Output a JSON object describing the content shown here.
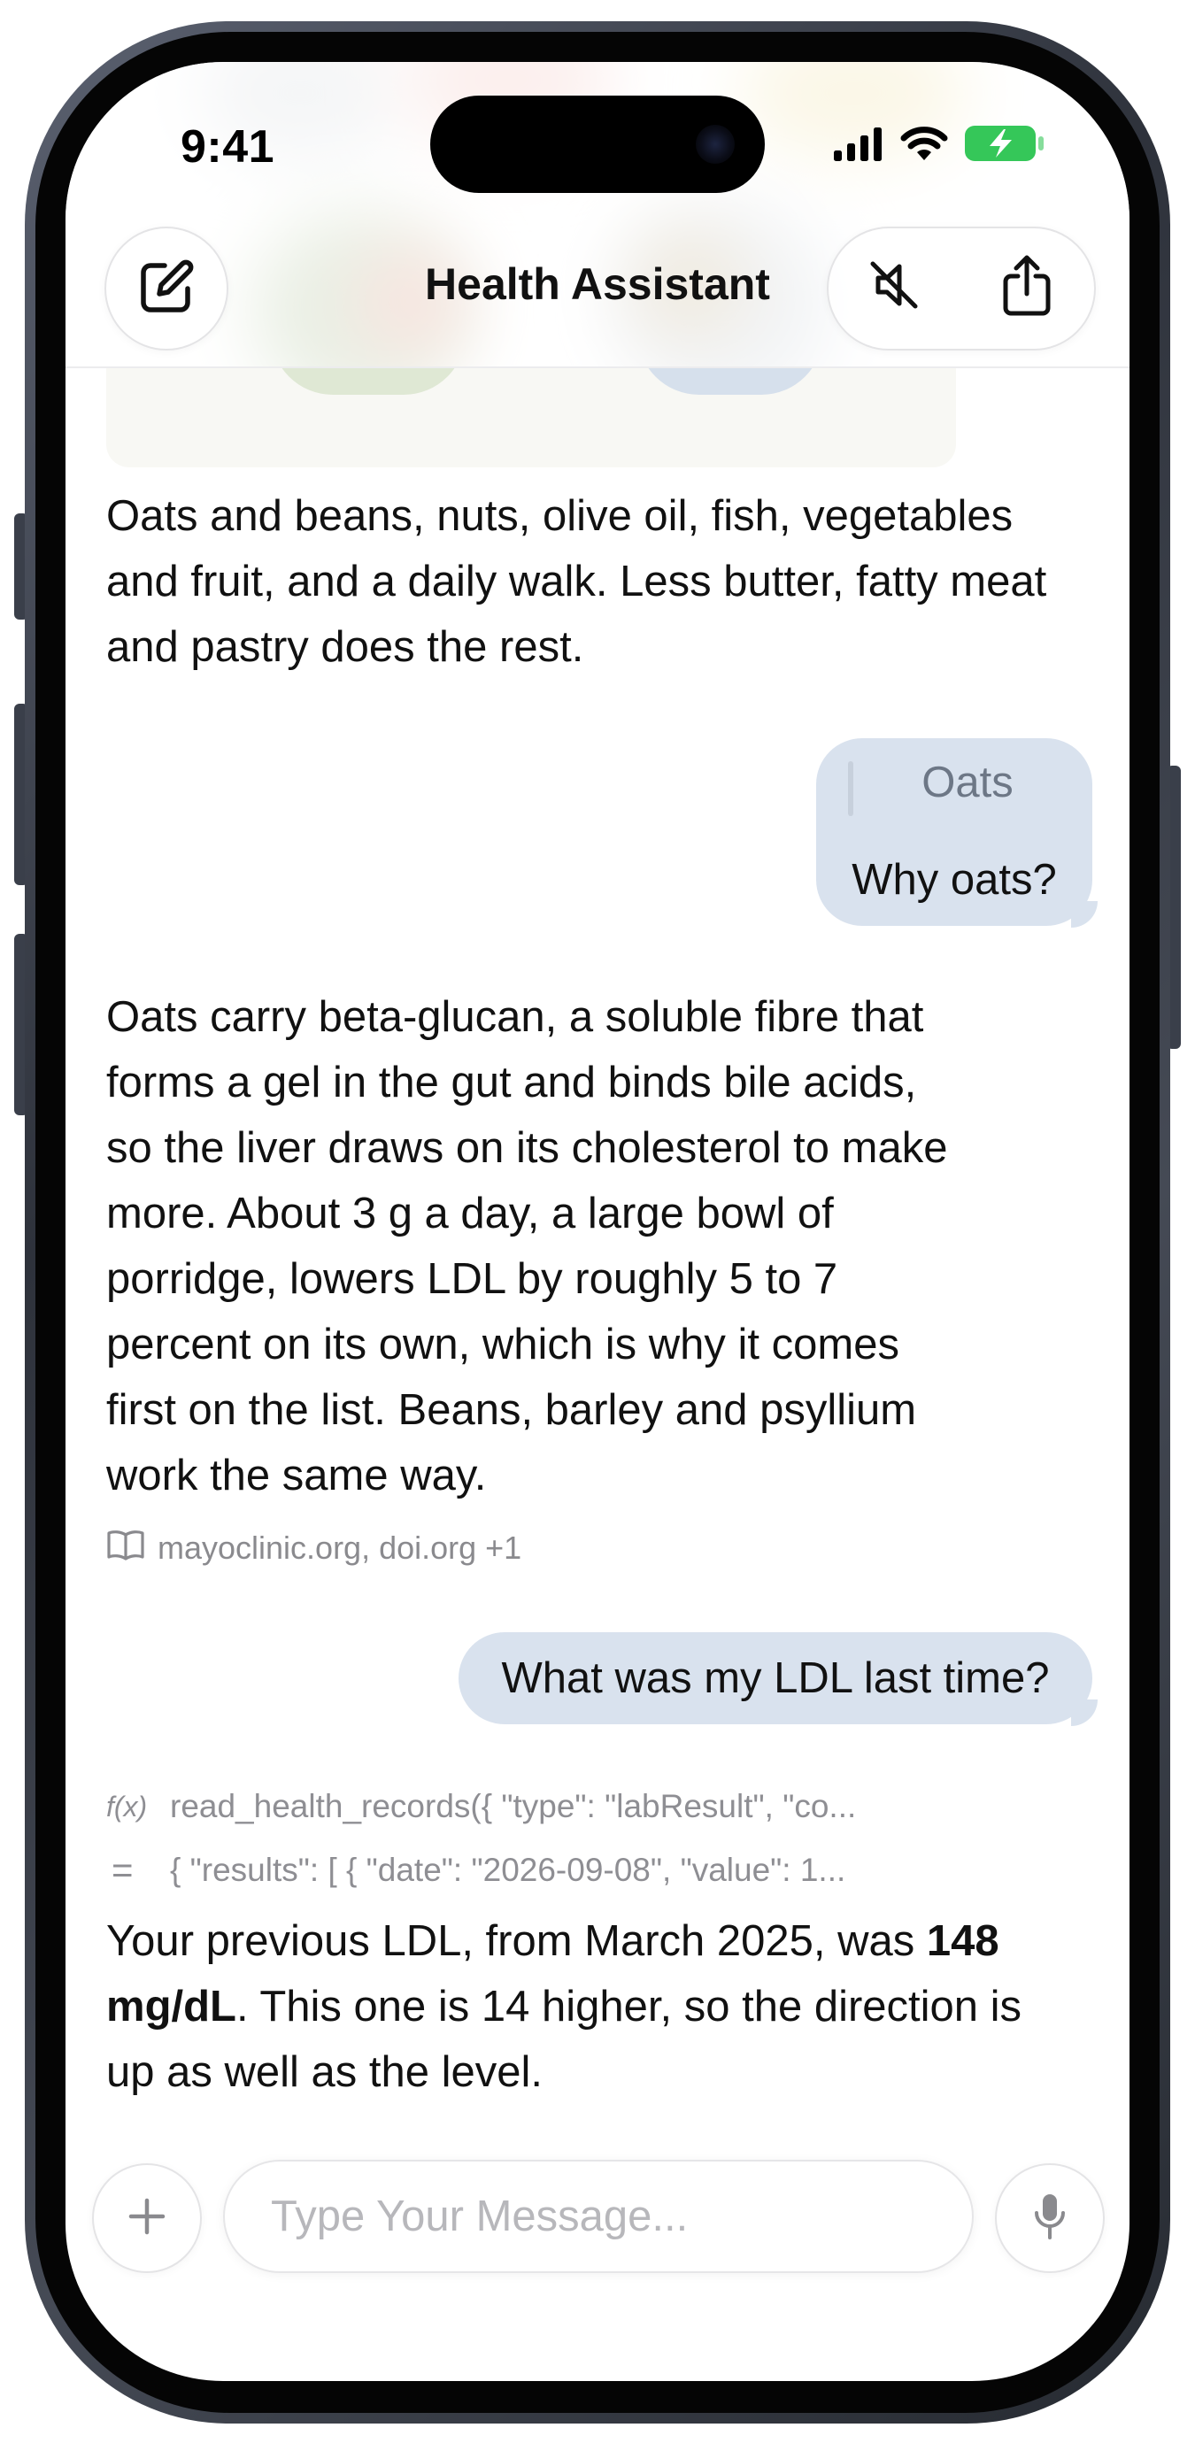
{
  "status_bar": {
    "time": "9:41",
    "icons": [
      "cellular-signal-icon",
      "wifi-icon",
      "battery-charging-icon"
    ]
  },
  "header": {
    "title": "Health Assistant",
    "left_button_icon": "compose-icon",
    "right_buttons_icons": [
      "speaker-muted-icon",
      "share-icon"
    ]
  },
  "messages": {
    "ai_intro": "Oats and beans, nuts, olive oil, fish, vegetables and fruit, and a daily walk. Less butter, fatty meat and pastry does the rest.",
    "user_quote": {
      "quoted": "Oats",
      "text": "Why oats?"
    },
    "ai_oats": "Oats carry beta-glucan, a soluble fibre that forms a gel in the gut and binds bile acids, so the liver draws on its cholesterol to make more. About 3 g a day, a large bowl of porridge, lowers LDL by roughly 5 to 7 percent on its own, which is why it comes first on the list. Beans, barley and psyllium work the same way.",
    "sources": "mayoclinic.org, doi.org +1",
    "user_ldl": "What was my LDL last time?",
    "tool_call": {
      "symbol": "f(x)",
      "text": "read_health_records({ \"type\": \"labResult\", \"co..."
    },
    "tool_result": {
      "symbol": "=",
      "text": "{ \"results\": [ { \"date\": \"2026-09-08\", \"value\": 1..."
    },
    "ai_ldl_before": "Your previous LDL, from March 2025, was ",
    "ai_ldl_bold": "148 mg/dL",
    "ai_ldl_after": ". This one is 14 higher, so the direction is up as well as the level."
  },
  "composer": {
    "placeholder": "Type Your Message...",
    "add_icon": "plus-icon",
    "mic_icon": "microphone-icon"
  },
  "colors": {
    "user_bubble": "#d9e2ee",
    "text": "#111111",
    "muted": "#8e8e93"
  }
}
